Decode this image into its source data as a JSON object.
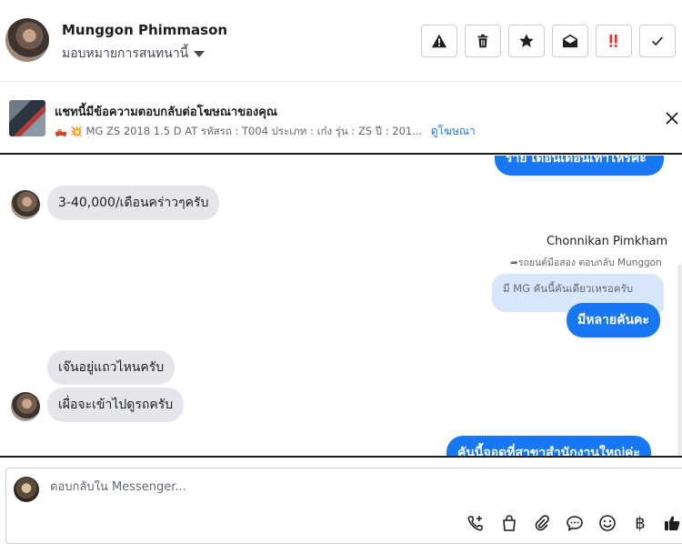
{
  "header": {
    "contact_name": "Munggon Phimmason",
    "assign_label": "มอบหมายการสนทนานี้",
    "tools": [
      {
        "name": "report-icon",
        "label": "!"
      },
      {
        "name": "trash-icon",
        "label": ""
      },
      {
        "name": "star-icon",
        "label": ""
      },
      {
        "name": "mark-unread-icon",
        "label": ""
      },
      {
        "name": "follow-up-icon",
        "label": "!!"
      },
      {
        "name": "done-icon",
        "label": ""
      }
    ],
    "colors": {
      "follow_up": "#e02f2f"
    }
  },
  "ad_banner": {
    "title": "แชทนี้มีข้อความตอบกลับต่อโฆษณาของคุณ",
    "emoji": "🛻 💥",
    "subtitle": "MG ZS 2018 1.5 D AT รหัสรถ : T004 ประเภท : เก๋ง รุ่น : ZS ปี : 201...",
    "link": "ดูโฆษณา"
  },
  "messages": {
    "top_cut_text": "ราย เดือนเดือนเท่าไหร่คะ",
    "incoming_1": "3-40,000/เดือนคร่าวๆครับ",
    "sender_name": "Chonnikan Pimkham",
    "reply_note": "รถยนต์มือสอง ตอบกลับ Munggon",
    "quoted_text": "มี MG คันนี้คันเดียวเหรอครับ",
    "outgoing_1": "มีหลายคันคะ",
    "incoming_2": "เจ๊นอยู่แถวไหนครับ",
    "incoming_3": "เผื่อจะเข้าไปดูรถครับ",
    "outgoing_2": "คันนี้จอดที่สาขาสำนักงานใหญ่ค่ะ"
  },
  "composer": {
    "placeholder": "ตอบกลับใน Messenger...",
    "icons": [
      "call-request-icon",
      "shopping-bag-icon",
      "paperclip-icon",
      "saved-reply-icon",
      "emoji-icon",
      "baht-payment-icon",
      "thumbs-up-icon"
    ],
    "baht_symbol": "฿"
  },
  "colors": {
    "accent": "#1877f2",
    "incoming_bubble": "#e4e6eb",
    "quoted_bubble": "#d8e6fb"
  }
}
